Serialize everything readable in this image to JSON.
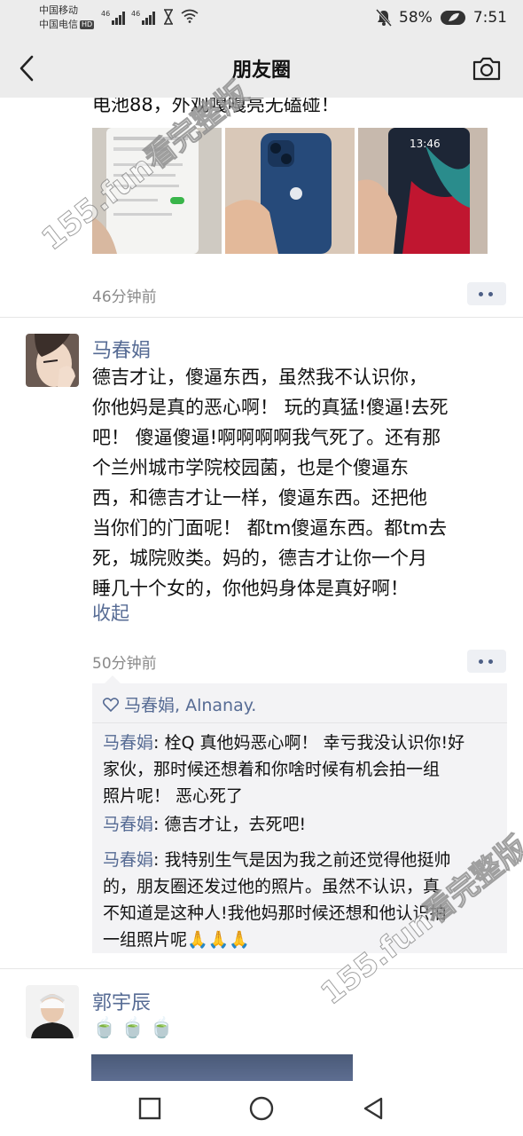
{
  "status_bar": {
    "carrier_1": "中国移动",
    "carrier_2": "中国电信",
    "hd_badge": "HD",
    "network_1": "46",
    "network_2": "46",
    "battery": "58%",
    "time": "7:51"
  },
  "nav": {
    "title": "朋友圈",
    "back_icon": "chevron-left-icon",
    "camera_icon": "camera-icon"
  },
  "post_top": {
    "text_tail": "电池88，外观嘎嘎亮无磕碰！",
    "photo_count": 3,
    "photo_3_clock": "13:46",
    "time": "46分钟前"
  },
  "post_main": {
    "author": "马春娟",
    "lines": [
      "德吉才让，傻逼东西，虽然我不认识你，",
      "你他妈是真的恶心啊！ 玩的真猛!傻逼!去死",
      "吧！ 傻逼傻逼!啊啊啊啊我气死了。还有那",
      "个兰州城市学院校园菌，也是个傻逼东",
      "西，和德吉才让一样，傻逼东西。还把他",
      "当你们的门面呢！ 都tm傻逼东西。都tm去",
      "死，城院败类。妈的，德吉才让你一个月",
      "睡几十个女的，你他妈身体是真好啊！"
    ],
    "collapse_label": "收起",
    "time": "50分钟前",
    "likes": "马春娟, Alnanay.",
    "comments": [
      {
        "name": "马春娟",
        "sep": ": ",
        "lines": [
          "栓Q 真他妈恶心啊！ 幸亏我没认识你!好",
          "家伙，那时候还想着和你啥时候有机会拍一组",
          "照片呢！ 恶心死了"
        ]
      },
      {
        "name": "马春娟",
        "sep": ": ",
        "lines": [
          "德吉才让，去死吧!"
        ]
      },
      {
        "name": "马春娟",
        "sep": ": ",
        "lines": [
          "我特别生气是因为我之前还觉得他挺帅",
          "的，朋友圈还发过他的照片。虽然不认识，真",
          "不知道是这种人!我他妈那时候还想和他认识拍",
          "一组照片呢🙏🙏🙏"
        ]
      }
    ]
  },
  "post_next": {
    "author": "郭宇辰",
    "emoji": [
      "🍵",
      "🍵",
      "🍵"
    ]
  },
  "watermark": {
    "text": "155.fun看完整版"
  },
  "system_nav": {
    "recent_icon": "square-icon",
    "home_icon": "circle-icon",
    "back_icon": "triangle-back-icon"
  }
}
